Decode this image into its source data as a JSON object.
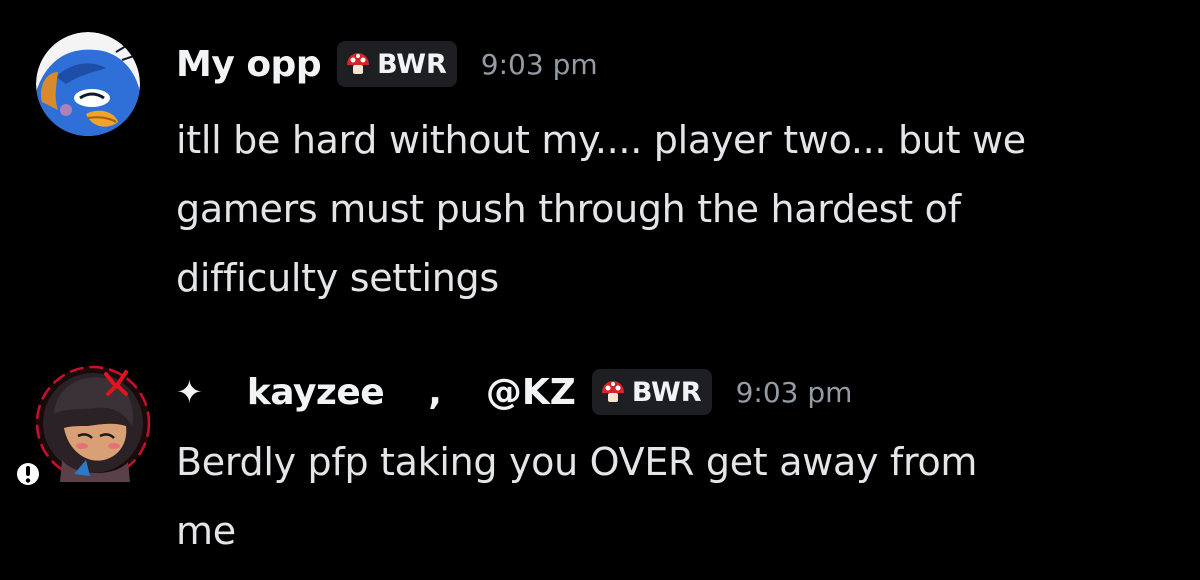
{
  "messages": [
    {
      "author": "My opp",
      "tag": "BWR",
      "timestamp": "9:03 pm",
      "content": "itll be hard without my.... player two... but we\ngamers must push through the hardest of\ndifficulty settings",
      "avatar_icon": "blue-bird-avatar",
      "colors": {
        "avatar_bg": "#ffffff",
        "avatar_bird": "#2f6fd8"
      }
    },
    {
      "sparkle": "✦",
      "author": "kayzee",
      "separator": ",",
      "handle": "@KZ",
      "tag": "BWR",
      "timestamp": "9:03 pm",
      "content": "Berdly pfp taking you OVER get away from\nme",
      "avatar_icon": "anime-character-avatar",
      "status_icon": "exclamation-icon",
      "colors": {
        "avatar_ring": "#c8102e"
      }
    }
  ],
  "colors": {
    "background": "#000000",
    "username": "#f2f3f5",
    "timestamp": "#949ba4",
    "tag_bg": "#1e1f22",
    "mushroom_red": "#d8232a"
  }
}
